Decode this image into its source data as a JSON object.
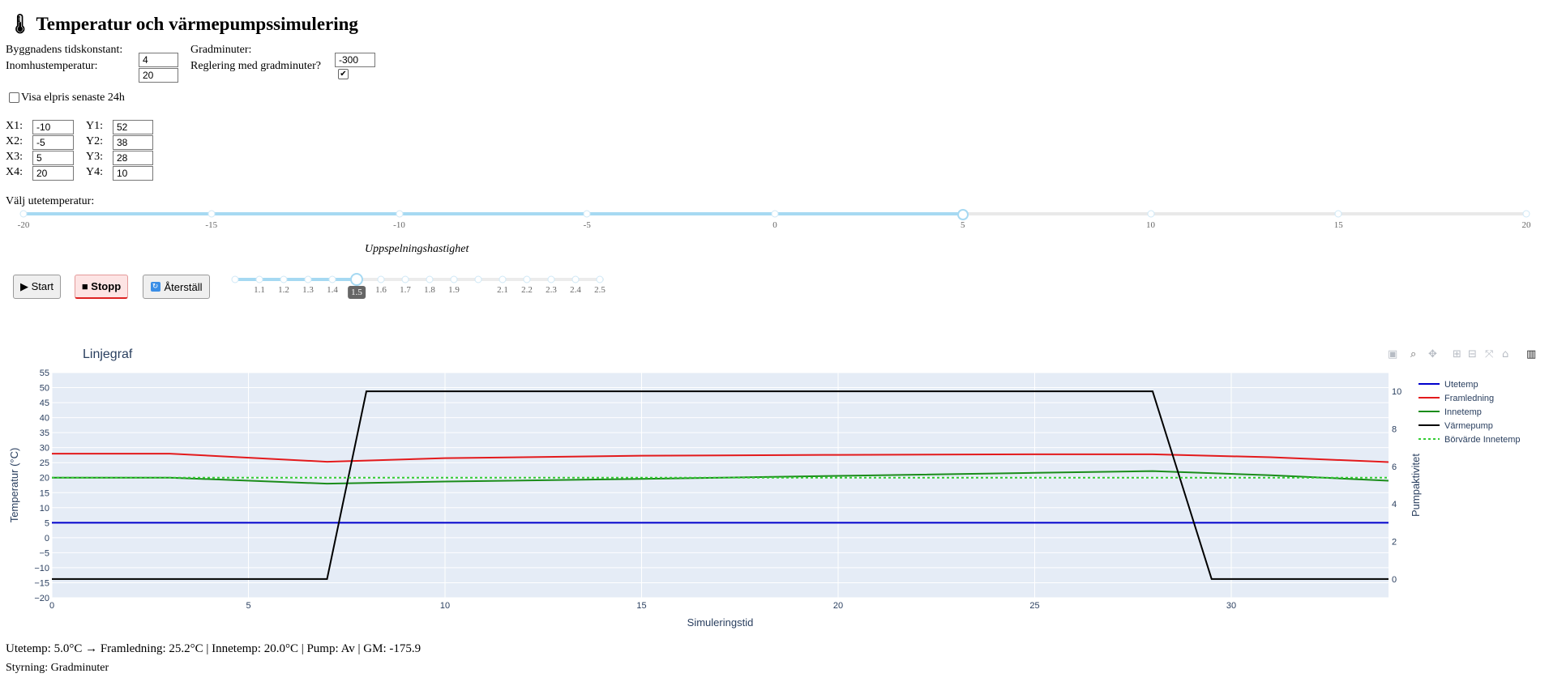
{
  "title": "🌡 Temperatur och värmepumpssimulering",
  "params": {
    "tidskonstant_label": "Byggnadens tidskonstant:",
    "tidskonstant_value": "4",
    "inomhus_label": "Inomhustemperatur:",
    "inomhus_value": "20",
    "gradminuter_label": "Gradminuter:",
    "gradminuter_value": "-300",
    "reglering_label": "Reglering med gradminuter?",
    "reglering_checked": true,
    "elpris_label": "Visa elpris senaste 24h",
    "elpris_checked": false
  },
  "curve_points": [
    {
      "xlabel": "X1:",
      "x": "-10",
      "ylabel": "Y1:",
      "y": "52"
    },
    {
      "xlabel": "X2:",
      "x": "-5",
      "ylabel": "Y2:",
      "y": "38"
    },
    {
      "xlabel": "X3:",
      "x": "5",
      "ylabel": "Y3:",
      "y": "28"
    },
    {
      "xlabel": "X4:",
      "x": "20",
      "ylabel": "Y4:",
      "y": "10"
    }
  ],
  "outdoor_slider": {
    "label": "Välj utetemperatur:",
    "min": -20,
    "max": 20,
    "value": 5,
    "ticks": [
      "-20",
      "-15",
      "-10",
      "-5",
      "0",
      "5",
      "10",
      "15",
      "20"
    ]
  },
  "speed_slider": {
    "label": "Uppspelningshastighet",
    "value": "1.5",
    "ticks": [
      "",
      "1.1",
      "1.2",
      "1.3",
      "1.4",
      "1.5",
      "1.6",
      "1.7",
      "1.8",
      "1.9",
      "",
      "2.1",
      "2.2",
      "2.3",
      "2.4",
      "2.5"
    ]
  },
  "buttons": {
    "start": "▶ Start",
    "stop": "■ Stopp",
    "reset": "Återställ"
  },
  "modebar_icons": [
    "camera-icon",
    "zoom-icon",
    "pan-icon",
    "zoom-in-icon",
    "zoom-out-icon",
    "autoscale-icon",
    "home-icon",
    "plotly-logo-icon"
  ],
  "status": {
    "line1": "Utetemp: 5.0°C → Framledning: 25.2°C | Innetemp: 20.0°C | Pump: Av | GM: -175.9",
    "line2": "Styrning: Gradminuter"
  },
  "chart_data": {
    "type": "line",
    "title": "Linjegraf",
    "xlabel": "Simuleringstid",
    "ylabel": "Temperatur (°C)",
    "y2label": "Pumpaktivitet",
    "xlim": [
      0,
      34
    ],
    "ylim": [
      -20,
      55
    ],
    "y2lim": [
      -1,
      11
    ],
    "xticks": [
      0,
      5,
      10,
      15,
      20,
      25,
      30
    ],
    "yticks": [
      -20,
      -15,
      -10,
      -5,
      0,
      5,
      10,
      15,
      20,
      25,
      30,
      35,
      40,
      45,
      50,
      55
    ],
    "y2ticks": [
      0,
      2,
      4,
      6,
      8,
      10
    ],
    "grid": true,
    "legend_position": "right",
    "series": [
      {
        "name": "Utetemp",
        "axis": "y",
        "color": "#0000cc",
        "dash": "solid",
        "x": [
          0,
          34
        ],
        "y": [
          5,
          5
        ]
      },
      {
        "name": "Framledning",
        "axis": "y",
        "color": "#e31a1c",
        "dash": "solid",
        "x": [
          0,
          3,
          7,
          10,
          15,
          20,
          25,
          28,
          31,
          34
        ],
        "y": [
          28,
          28,
          25.3,
          26.5,
          27.3,
          27.6,
          27.8,
          27.8,
          26.8,
          25.2
        ]
      },
      {
        "name": "Innetemp",
        "axis": "y",
        "color": "#1a8c1a",
        "dash": "solid",
        "x": [
          0,
          3,
          7,
          10,
          15,
          20,
          25,
          28,
          31,
          34
        ],
        "y": [
          20,
          20,
          18,
          18.7,
          19.6,
          20.6,
          21.6,
          22.2,
          20.8,
          19
        ]
      },
      {
        "name": "Värmepump",
        "axis": "y2",
        "color": "#000000",
        "dash": "solid",
        "x": [
          0,
          7,
          8,
          28,
          29.5,
          34
        ],
        "y": [
          0,
          0,
          10,
          10,
          0,
          0
        ]
      },
      {
        "name": "Börvärde Innetemp",
        "axis": "y",
        "color": "#33cc33",
        "dash": "dot",
        "x": [
          0,
          34
        ],
        "y": [
          20,
          20
        ]
      }
    ]
  }
}
